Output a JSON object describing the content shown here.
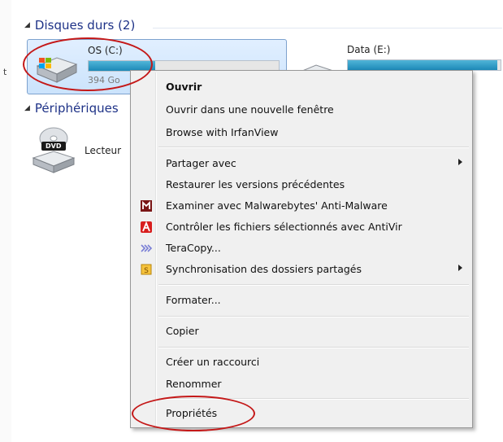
{
  "explorer": {
    "groups": {
      "hard_drives": "Disques durs (2)",
      "devices": "Périphériques"
    },
    "left_stub": "t",
    "drives": [
      {
        "name": "OS (C:)",
        "free_text": "394 Go",
        "used_fraction": 0.35
      },
      {
        "name": "Data (E:)",
        "used_fraction": 0.98
      }
    ],
    "dvd": {
      "badge": "DVD",
      "label": "Lecteur"
    }
  },
  "context_menu": {
    "items": [
      {
        "label": "Ouvrir",
        "bold": true
      },
      {
        "label": "Ouvrir dans une nouvelle fenêtre"
      },
      {
        "label": "Browse with IrfanView"
      },
      {
        "label": "Partager avec",
        "submenu": true
      },
      {
        "label": "Restaurer les versions précédentes"
      },
      {
        "label": "Examiner avec Malwarebytes' Anti-Malware",
        "icon": "malwarebytes-icon"
      },
      {
        "label": "Contrôler les fichiers sélectionnés avec AntiVir",
        "icon": "antivir-icon"
      },
      {
        "label": "TeraCopy...",
        "icon": "teracopy-icon"
      },
      {
        "label": "Synchronisation des dossiers partagés",
        "icon": "sync-icon",
        "submenu": true
      },
      {
        "label": "Formater..."
      },
      {
        "label": "Copier"
      },
      {
        "label": "Créer un raccourci"
      },
      {
        "label": "Renommer"
      },
      {
        "label": "Propriétés"
      }
    ]
  },
  "colors": {
    "annotation": "#c41818",
    "group_title": "#1e3287",
    "drive_fill": "#1d89b7",
    "selection": "#cbe3fc"
  }
}
